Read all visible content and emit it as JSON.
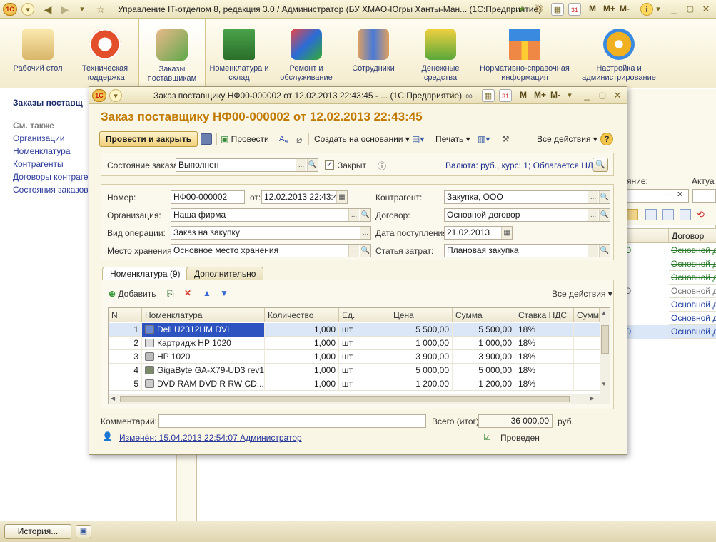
{
  "app": {
    "window_title": "Управление IT-отделом 8, редакция 3.0 / Администратор (БУ ХМАО-Югры Ханты-Ман...  (1С:Предприятие)",
    "m_buttons": [
      "M",
      "M+",
      "M-"
    ]
  },
  "sections": [
    {
      "label": "Рабочий стол",
      "icon": "desk-icon"
    },
    {
      "label": "Техническая поддержка",
      "icon": "lifebuoy-icon"
    },
    {
      "label": "Заказы поставщикам",
      "icon": "hand-money-icon"
    },
    {
      "label": "Номенклатура и склад",
      "icon": "circuit-board-icon"
    },
    {
      "label": "Ремонт и обслуживание",
      "icon": "windows-box-icon"
    },
    {
      "label": "Сотрудники",
      "icon": "employees-icon"
    },
    {
      "label": "Денежные средства",
      "icon": "coins-icon"
    },
    {
      "label": "Нормативно-справочная информация",
      "icon": "hierarchy-icon"
    },
    {
      "label": "Настройка и администрирование",
      "icon": "gears-icon"
    }
  ],
  "left_panel": {
    "header": "Заказы поставщ",
    "see_also": "См. также",
    "links": [
      "Организации",
      "Номенклатура",
      "Контрагенты",
      "Договоры контраген",
      "Состояния заказов п"
    ]
  },
  "background_list": {
    "label_1": "яние:",
    "label_2": "Актуа",
    "col_header": "Договор",
    "marks": [
      "О",
      "",
      "",
      "О",
      "",
      "",
      "О"
    ],
    "rows": [
      "Основной д",
      "Основной д",
      "Основной д",
      "Основной д",
      "Основной д",
      "Основной д",
      "Основной д"
    ]
  },
  "bottom_bar": {
    "history": "История..."
  },
  "doc_window": {
    "title": "Заказ поставщику НФ00-000002 от 12.02.2013 22:43:45 - ...  (1С:Предприятие)",
    "heading": "Заказ поставщику НФ00-000002 от 12.02.2013 22:43:45",
    "toolbar": {
      "post_close": "Провести и закрыть",
      "post": "Провести",
      "create_based": "Создать на основании",
      "print": "Печать",
      "all_actions": "Все действия"
    },
    "state": {
      "label": "Состояние заказа:",
      "value": "Выполнен",
      "closed_label": "Закрыт",
      "closed": true,
      "currency_info": "Валюта: руб., курс: 1; Облагается НДС"
    },
    "fields": {
      "number_label": "Номер:",
      "number": "НФ00-000002",
      "date_label": "от:",
      "date": "12.02.2013 22:43:45",
      "org_label": "Организация:",
      "org": "Наша фирма",
      "op_label": "Вид операции:",
      "op": "Заказ на закупку",
      "storage_label": "Место хранения:",
      "storage": "Основное место хранения",
      "contractor_label": "Контрагент:",
      "contractor": "Закупка, ООО",
      "contract_label": "Договор:",
      "contract": "Основной договор",
      "receipt_label": "Дата поступления:",
      "receipt": "21.02.2013",
      "expense_label": "Статья затрат:",
      "expense": "Плановая закупка"
    },
    "tabs": [
      "Номенклатура (9)",
      "Дополнительно"
    ],
    "table_toolbar": {
      "add": "Добавить",
      "all_actions": "Все действия"
    },
    "table": {
      "columns": [
        "N",
        "Номенклатура",
        "Количество",
        "Ед.",
        "Цена",
        "Сумма",
        "Ставка НДС",
        "Сумма"
      ],
      "rows": [
        {
          "n": "1",
          "name": "Dell U2312HM DVI",
          "qty": "1,000",
          "unit": "шт",
          "price": "5 500,00",
          "sum": "5 500,00",
          "vat": "18%"
        },
        {
          "n": "2",
          "name": "Картридж HP 1020",
          "qty": "1,000",
          "unit": "шт",
          "price": "1 000,00",
          "sum": "1 000,00",
          "vat": "18%"
        },
        {
          "n": "3",
          "name": "HP 1020",
          "qty": "1,000",
          "unit": "шт",
          "price": "3 900,00",
          "sum": "3 900,00",
          "vat": "18%"
        },
        {
          "n": "4",
          "name": "GigaByte GA-X79-UD3 rev1...",
          "qty": "1,000",
          "unit": "шт",
          "price": "5 000,00",
          "sum": "5 000,00",
          "vat": "18%"
        },
        {
          "n": "5",
          "name": "DVD RAM DVD R RW  CD...",
          "qty": "1,000",
          "unit": "шт",
          "price": "1 200,00",
          "sum": "1 200,00",
          "vat": "18%"
        }
      ]
    },
    "comment_label": "Комментарий:",
    "comment": "",
    "total_label": "Всего (итог):",
    "total": "36 000,00",
    "currency": "руб.",
    "changed": "Изменён: 15.04.2013 22:54:07 Администратор",
    "posted": "Проведен"
  }
}
